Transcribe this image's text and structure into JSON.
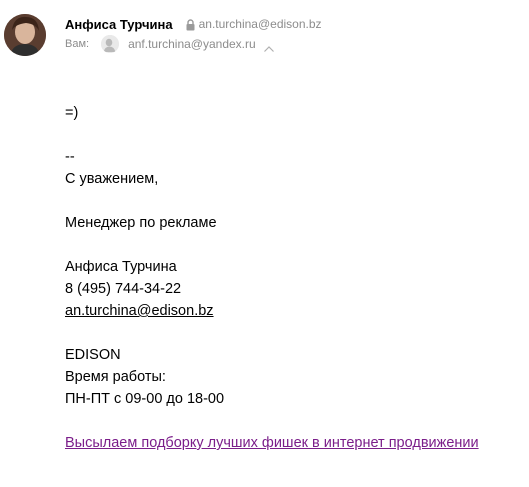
{
  "header": {
    "sender_name": "Анфиса Турчина",
    "sender_email": "an.turchina@edison.bz",
    "to_label": "Вам:",
    "recipient_email": "anf.turchina@yandex.ru"
  },
  "body": {
    "smile": "=)",
    "sig_dash": "--",
    "regards": "С уважением,",
    "position": "Менеджер по рекламе",
    "name": "Анфиса Турчина",
    "phone": "8 (495) 744-34-22",
    "email": "an.turchina@edison.bz",
    "company": "EDISON",
    "hours_label": "Время работы:",
    "hours": "ПН-ПТ с 09-00 до 18-00",
    "promo_link": "Высылаем подборку лучших фишек в интернет продвижении"
  },
  "colors": {
    "muted_text": "#8c8c8c",
    "promo_link": "#7b1e8a"
  },
  "icons": {
    "lock": "lock-icon",
    "chevron": "chevron-up-icon"
  }
}
